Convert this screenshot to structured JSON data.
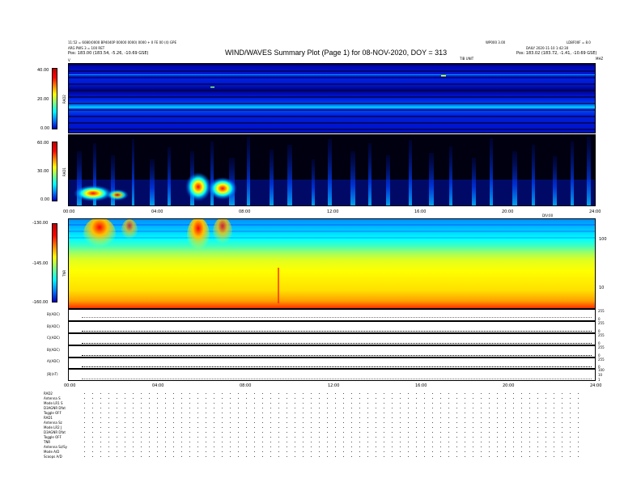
{
  "header": {
    "line1": "11:52 = 6080(0000 BP4040P 00000 0000) 0000 + 0 FE 00 (4) GPE",
    "line2": "ARG PWS 3 = 100 RET",
    "pos_left": "Pos: 183.00 (183.54, -5.26, -10.69 GSE)",
    "title": "WIND/WAVES Summary Plot (Page 1) for 08-NOV-2020, DOY = 313",
    "right_top_a": "WP000 3.00",
    "right_top_b": "LD8F00F = 8.0",
    "right_mid": "DAILY 2020-11-10 1:42:30",
    "pos_right": "Pos: 183.02 (183.72, -1.41, -10.69 GSE)",
    "center_small": "TIB UNIT",
    "right_small": "MHZ",
    "left_small": "V"
  },
  "panels": {
    "rad2": {
      "label": "RAD2",
      "ticks": [
        "40.00",
        "20.00",
        "0.00"
      ]
    },
    "rad1": {
      "label": "RAD1",
      "ticks": [
        "60.00",
        "30.00",
        "0.00"
      ]
    },
    "tnr": {
      "label": "TNR",
      "ticks": [
        "-130.00",
        "-145.00",
        "-160.00"
      ],
      "right_ticks": [
        "100",
        "10"
      ]
    }
  },
  "time_axis": {
    "ticks": [
      "00:00",
      "04:00",
      "08:00",
      "12:00",
      "16:00",
      "20:00",
      "24:00"
    ],
    "unit": "DIV:00"
  },
  "line_panels": [
    {
      "label": "B|(ADC)",
      "right_ticks": [
        "255",
        "0"
      ]
    },
    {
      "label": "B|(ADC)",
      "right_ticks": [
        "255",
        "0"
      ]
    },
    {
      "label": "C|(ADC)",
      "right_ticks": [
        "255",
        "0"
      ]
    },
    {
      "label": "B|(ADC)",
      "right_ticks": [
        "255",
        "0"
      ]
    },
    {
      "label": "A|(ADC)",
      "right_ticks": [
        "255",
        "0"
      ]
    },
    {
      "label": "|B|(nT)",
      "right_ticks": [
        "100",
        "10",
        "1"
      ]
    }
  ],
  "footer": {
    "rad2": [
      "RAD2",
      "Antenna  S",
      "Mode  LR1 S",
      "D3AGNR  Dfat",
      "Toggle  OFF"
    ],
    "rad1": [
      "RAD1",
      "Antenna  Sz",
      "Mode  LR2 J",
      "D3AGNR  Dfat",
      "Toggle  OFF",
      "TNR",
      "Antenna  Sz/Sy",
      "Mode  A/D",
      "Scoops  A/D"
    ]
  },
  "chart_data": {
    "type": "heatmap",
    "title": "WIND/WAVES Summary Plot (Page 1) for 08-NOV-2020, DOY = 313",
    "x_range": [
      "00:00",
      "24:00"
    ],
    "panels": [
      {
        "name": "RAD2",
        "y_range": [
          0,
          40
        ],
        "ticks": [
          0,
          20,
          40
        ]
      },
      {
        "name": "RAD1",
        "y_range": [
          0,
          60
        ],
        "ticks": [
          0,
          30,
          60
        ]
      },
      {
        "name": "TNR",
        "y_range": [
          -160,
          -130
        ],
        "ticks": [
          -160,
          -145,
          -130
        ]
      }
    ],
    "colors": {
      "low": "#0000c0",
      "mid": "#00e0ff",
      "high": "#ffff00",
      "peak": "#ff0000"
    }
  }
}
